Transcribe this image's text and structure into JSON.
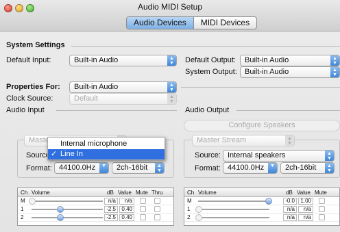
{
  "window": {
    "title": "Audio MIDI Setup"
  },
  "tabs": [
    {
      "label": "Audio Devices"
    },
    {
      "label": "MIDI Devices"
    }
  ],
  "system_settings": {
    "heading": "System Settings",
    "default_input_label": "Default Input:",
    "default_input_value": "Built-in Audio",
    "default_output_label": "Default Output:",
    "default_output_value": "Built-in Audio",
    "system_output_label": "System Output:",
    "system_output_value": "Built-in Audio"
  },
  "properties": {
    "label": "Properties For:",
    "value": "Built-in Audio",
    "clock_source_label": "Clock Source:",
    "clock_source_value": "Default"
  },
  "audio_input": {
    "heading": "Audio Input",
    "stream_value": "Master Stream",
    "source_label": "Source:",
    "source_menu": [
      {
        "label": "Internal microphone",
        "selected": false
      },
      {
        "label": "Line In",
        "selected": true
      }
    ],
    "format_label": "Format:",
    "format_rate": "44100.0Hz",
    "format_bits": "2ch-16bit"
  },
  "audio_output": {
    "heading": "Audio Output",
    "configure_button": "Configure Speakers",
    "stream_value": "Master Stream",
    "source_label": "Source:",
    "source_value": "Internal speakers",
    "format_label": "Format:",
    "format_rate": "44100.0Hz",
    "format_bits": "2ch-16bit"
  },
  "input_table": {
    "headers": {
      "ch": "Ch",
      "volume": "Volume",
      "db": "dB",
      "value": "Value",
      "mute": "Mute",
      "thru": "Thru"
    },
    "rows": [
      {
        "ch": "M",
        "db": "n/a",
        "value": "n/a",
        "level": 0.0,
        "enabled": false
      },
      {
        "ch": "1",
        "db": "-2.5",
        "value": "0.40",
        "level": 0.4,
        "enabled": true
      },
      {
        "ch": "2",
        "db": "-2.5",
        "value": "0.40",
        "level": 0.4,
        "enabled": true
      }
    ]
  },
  "output_table": {
    "headers": {
      "ch": "Ch",
      "volume": "Volume",
      "db": "dB",
      "value": "Value",
      "mute": "Mute"
    },
    "rows": [
      {
        "ch": "M",
        "db": "-0.0",
        "value": "1.00",
        "level": 1.0,
        "enabled": true
      },
      {
        "ch": "1",
        "db": "n/a",
        "value": "n/a",
        "level": 0.0,
        "enabled": false
      },
      {
        "ch": "2",
        "db": "n/a",
        "value": "n/a",
        "level": 0.0,
        "enabled": false
      }
    ]
  },
  "colors": {
    "accent": "#3f86d8",
    "selection": "#2f6fe0"
  }
}
